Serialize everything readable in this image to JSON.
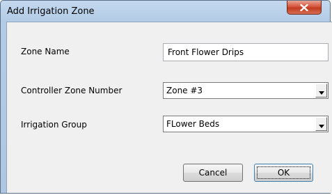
{
  "window": {
    "title": "Add Irrigation Zone",
    "close_icon": "close-icon"
  },
  "form": {
    "zone_name": {
      "label": "Zone Name",
      "value": "Front Flower Drips"
    },
    "controller_zone_number": {
      "label": "Controller Zone Number",
      "selected": "Zone #3"
    },
    "irrigation_group": {
      "label": "Irrigation Group",
      "selected": "FLower Beds"
    }
  },
  "buttons": {
    "cancel_label": "Cancel",
    "ok_label": "OK"
  },
  "colors": {
    "frame": "#b3cbe6",
    "close_button": "#c9452a",
    "client": "#f0f0f0"
  }
}
